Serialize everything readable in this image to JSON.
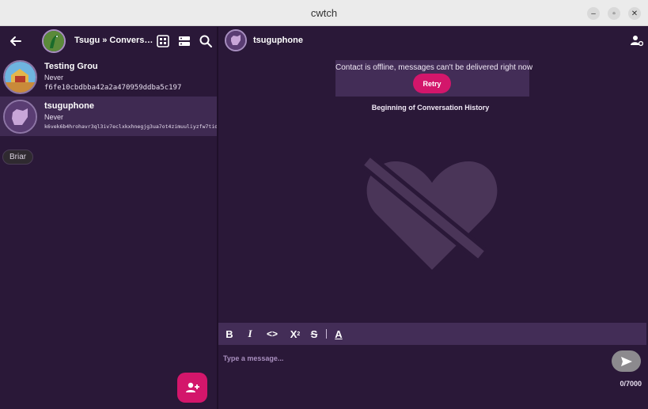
{
  "window": {
    "title": "cwtch",
    "minimize_icon": "minimize-icon",
    "maximize_icon": "maximize-icon",
    "close_icon": "close-icon"
  },
  "left_header": {
    "title": "Tsugu » Convers…",
    "icons": [
      "back-arrow-icon",
      "qr-code-icon",
      "server-icon",
      "search-icon"
    ]
  },
  "contacts": [
    {
      "name": "Testing Grou",
      "status": "Never",
      "id": "f6fe10cbdbba42a2a470959ddba5c197"
    },
    {
      "name": "tsuguphone",
      "status": "Never",
      "id": "k6vek6b4hrohavr3ql3iv7eclxkxhnegjg3ua7ot4zimuuliyzfw7tid"
    }
  ],
  "tag_chip": "Briar",
  "add_contact_icon": "add-contact-icon",
  "conversation": {
    "contact_name": "tsuguphone",
    "settings_icon": "contact-settings-icon",
    "offline_message": "Contact is offline, messages can't be delivered right now",
    "retry_label": "Retry",
    "history_label": "Beginning of Conversation History",
    "empty_state_icon": "broken-heart-icon"
  },
  "format_toolbar": {
    "bold": "B",
    "italic": "I",
    "code": "<>",
    "superscript": "X",
    "superscript_mark": "2",
    "strikethrough": "S",
    "color": "A"
  },
  "compose": {
    "placeholder": "Type a message...",
    "counter": "0/7000",
    "send_icon": "send-icon"
  },
  "colors": {
    "accent": "#d3166b",
    "background": "#2a1838",
    "panel": "#432d57"
  }
}
